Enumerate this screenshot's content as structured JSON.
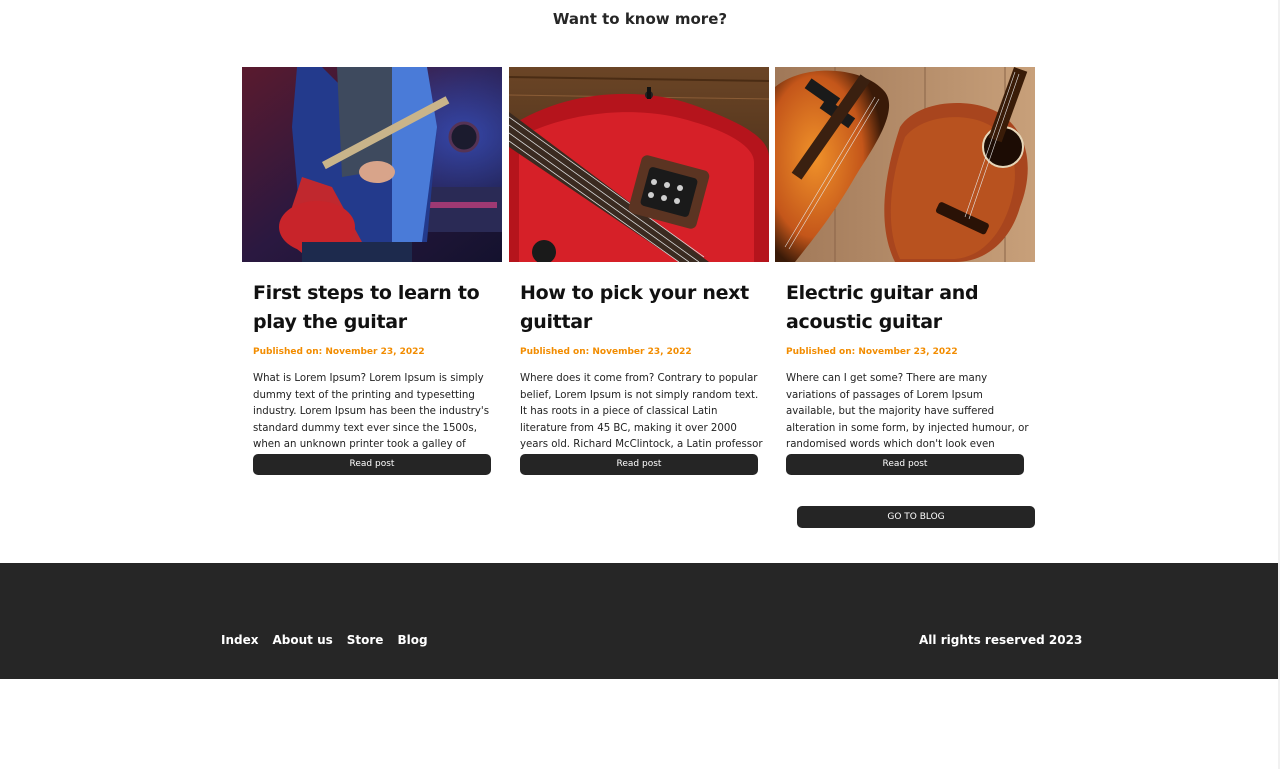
{
  "section": {
    "title": "Want to know more?"
  },
  "posts": [
    {
      "title": "First steps to learn to play the guitar",
      "date": "Published on: November 23, 2022",
      "excerpt": "What is Lorem Ipsum? Lorem Ipsum is simply dummy text of the printing and typesetting industry. Lorem Ipsum has been the industry's standard dummy text ever since the 1500s, when an unknown printer took a galley of type...",
      "button": "Read post"
    },
    {
      "title": "How to pick your next guittar",
      "date": "Published on: November 23, 2022",
      "excerpt": "Where does it come from? Contrary to popular belief, Lorem Ipsum is not simply random text. It has roots in a piece of classical Latin literature from 45 BC, making it over 2000 years old. Richard McClintock, a Latin professor at...",
      "button": "Read post"
    },
    {
      "title": "Electric guitar and acoustic guitar",
      "date": "Published on: November 23, 2022",
      "excerpt": "Where can I get some? There are many variations of passages of Lorem Ipsum available, but the majority have suffered alteration in some form, by injected humour, or randomised words which don't look even slightl...",
      "button": "Read post"
    }
  ],
  "blog_button": "GO TO BLOG",
  "footer": {
    "nav": [
      "Index",
      "About us",
      "Store",
      "Blog"
    ],
    "copyright": "All rights reserved 2023"
  },
  "colors": {
    "accent": "#f28c00",
    "dark": "#262626"
  }
}
